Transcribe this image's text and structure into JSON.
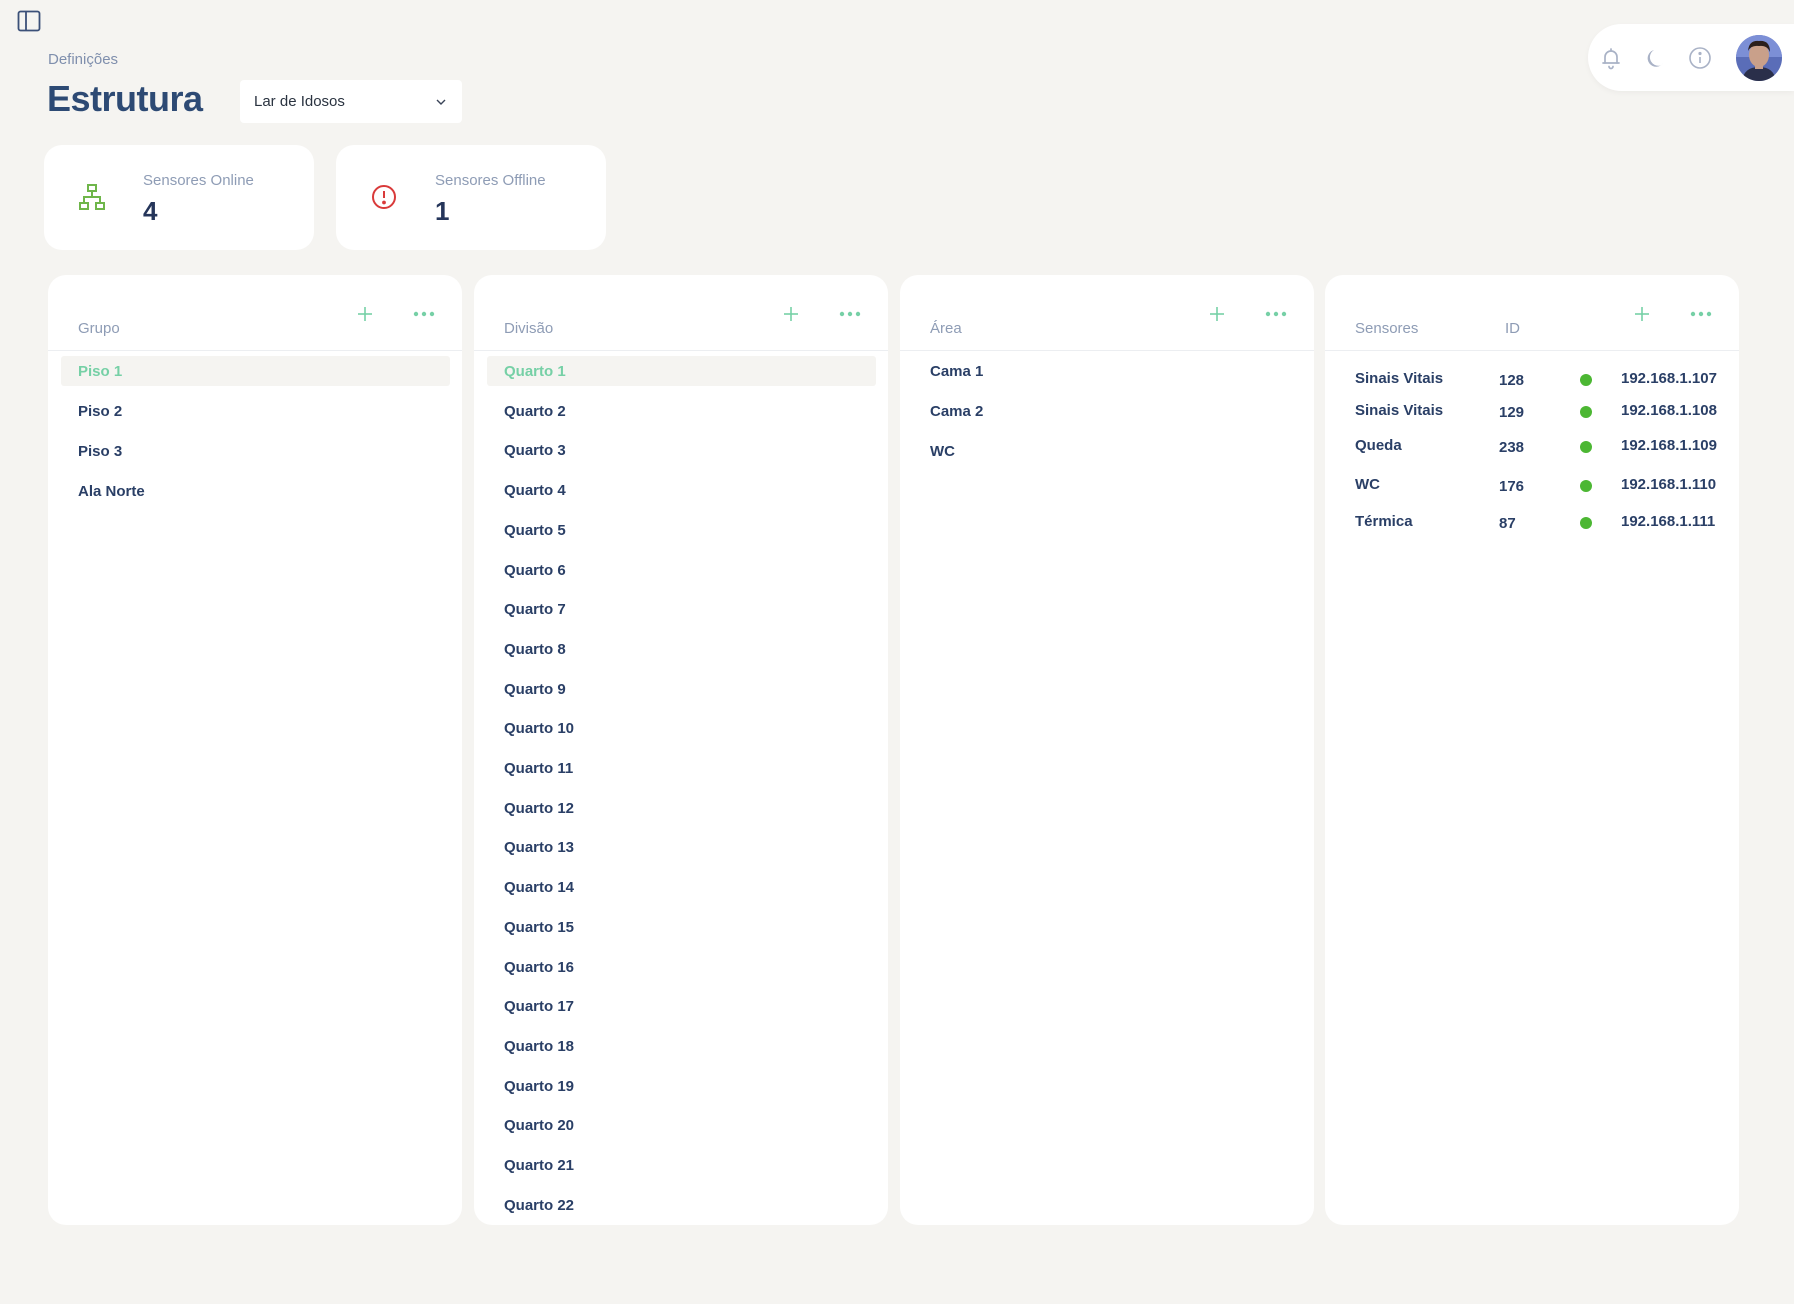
{
  "header": {
    "breadcrumb": "Definições",
    "title": "Estrutura",
    "org_select": {
      "value": "Lar de Idosos"
    }
  },
  "top_actions": {
    "icons": [
      "bell-icon",
      "moon-icon",
      "info-icon"
    ],
    "avatar": "user-avatar"
  },
  "stats": [
    {
      "label": "Sensores Online",
      "value": "4",
      "icon": "network-icon",
      "color": "#6fb64a"
    },
    {
      "label": "Sensores Offline",
      "value": "1",
      "icon": "alert-circle-icon",
      "color": "#d93a3a"
    }
  ],
  "accent": "#76d0a6",
  "panels": {
    "grupo": {
      "label": "Grupo",
      "items": [
        "Piso 1",
        "Piso 2",
        "Piso 3",
        "Ala Norte"
      ],
      "selected": "Piso 1"
    },
    "divisao": {
      "label": "Divisão",
      "items": [
        "Quarto 1",
        "Quarto 2",
        "Quarto 3",
        "Quarto 4",
        "Quarto 5",
        "Quarto 6",
        "Quarto 7",
        "Quarto 8",
        "Quarto 9",
        "Quarto 10",
        "Quarto 11",
        "Quarto 12",
        "Quarto 13",
        "Quarto 14",
        "Quarto 15",
        "Quarto 16",
        "Quarto 17",
        "Quarto 18",
        "Quarto 19",
        "Quarto 20",
        "Quarto 21",
        "Quarto 22"
      ],
      "selected": "Quarto 1"
    },
    "area": {
      "label": "Área",
      "items": [
        "Cama 1",
        "Cama 2",
        "WC"
      ]
    },
    "sensores": {
      "label": "Sensores",
      "id_label": "ID",
      "status_color": "#4cb733",
      "rows": [
        {
          "name": "Sinais Vitais",
          "id": "128",
          "ip": "192.168.1.107"
        },
        {
          "name": "Sinais Vitais",
          "id": "129",
          "ip": "192.168.1.108"
        },
        {
          "name": "Queda",
          "id": "238",
          "ip": "192.168.1.109"
        },
        {
          "name": "WC",
          "id": "176",
          "ip": "192.168.1.110"
        },
        {
          "name": "Térmica",
          "id": "87",
          "ip": "192.168.1.111"
        }
      ]
    }
  }
}
